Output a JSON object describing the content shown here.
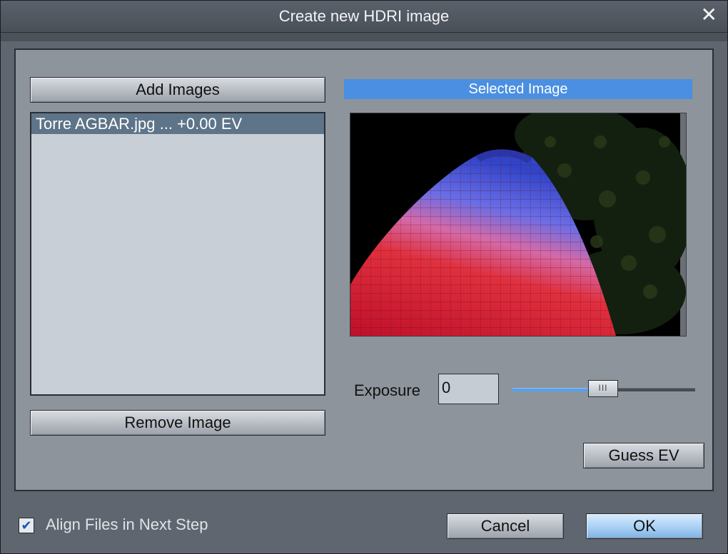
{
  "window": {
    "title": "Create new HDRI image",
    "close_glyph": "✕"
  },
  "left": {
    "add_button": "Add Images",
    "remove_button": "Remove Image",
    "files": [
      {
        "label": "Torre AGBAR.jpg ... +0.00 EV"
      }
    ]
  },
  "right": {
    "header": "Selected Image",
    "preview_icon": "photo-preview-image",
    "exposure_label": "Exposure",
    "exposure_value": "0",
    "exposure_slider_fraction": 0.495,
    "thumb_grip": "III",
    "guess_button": "Guess EV"
  },
  "footer": {
    "align_label": "Align Files in Next Step",
    "align_checked": true,
    "check_glyph": "✔",
    "cancel_button": "Cancel",
    "ok_button": "OK"
  },
  "colors": {
    "accent": "#4a8fe2",
    "selection": "#5e7489",
    "panel": "#8d949c"
  }
}
